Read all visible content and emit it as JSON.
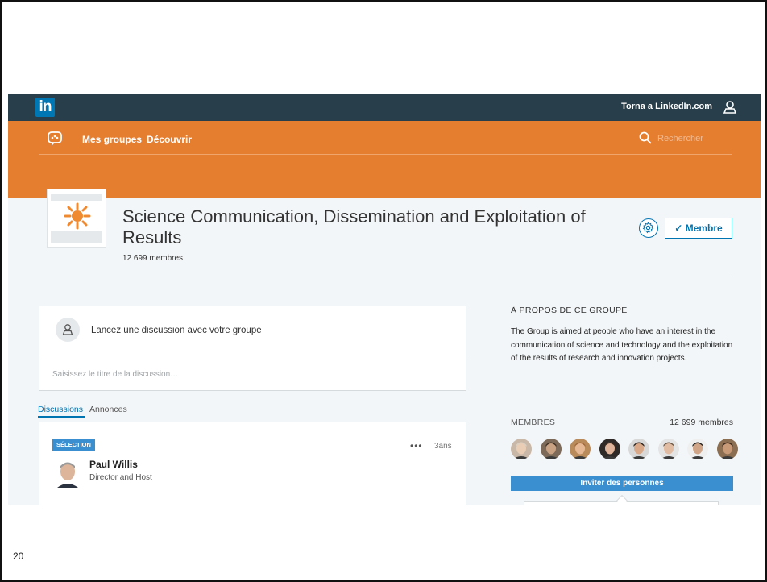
{
  "topbar": {
    "logo_text": "in",
    "back_link": "Torna a LinkedIn.com"
  },
  "nav": {
    "my_groups": "Mes groupes",
    "discover": "Découvrir",
    "search_placeholder": "Rechercher"
  },
  "group": {
    "title": "Science Communication, Dissemination and Exploitation of Results",
    "member_count": "12 699 membres",
    "member_button": "✓ Membre"
  },
  "discussion": {
    "prompt": "Lancez une discussion avec votre groupe",
    "title_placeholder": "Saisissez le titre de la discussion…"
  },
  "tabs": {
    "discussions": "Discussions",
    "announcements": "Annonces"
  },
  "post": {
    "badge": "SÉLECTION",
    "more": "•••",
    "time": "3ans",
    "author": "Paul Willis",
    "role": "Director and Host"
  },
  "about": {
    "heading": "À PROPOS DE CE GROUPE",
    "text": "The Group is aimed at people who have an interest in the communication of science and technology and the exploitation of the results of research and innovation projects."
  },
  "members": {
    "heading": "MEMBRES",
    "count": "12 699 membres",
    "invite_button": "Inviter des personnes",
    "faces": [
      {
        "name": "member-avatar-1",
        "bg": "#c9b8a8",
        "skin": "#e9cdb5",
        "hair": "#d8d0c4"
      },
      {
        "name": "member-avatar-2",
        "bg": "#7d6a58",
        "skin": "#c9a283",
        "hair": "#3d2f25"
      },
      {
        "name": "member-avatar-3",
        "bg": "#b98a5a",
        "skin": "#e6b894",
        "hair": "#a0683a"
      },
      {
        "name": "member-avatar-4",
        "bg": "#2f2a28",
        "skin": "#e0b49a",
        "hair": "#3a2a20"
      },
      {
        "name": "member-avatar-5",
        "bg": "#d8d8d8",
        "skin": "#d8a888",
        "hair": "#2a2220"
      },
      {
        "name": "member-avatar-6",
        "bg": "#e4e4e4",
        "skin": "#e1bca2",
        "hair": "#6a5848"
      },
      {
        "name": "member-avatar-7",
        "bg": "#efefef",
        "skin": "#cfa487",
        "hair": "#222222"
      },
      {
        "name": "member-avatar-8",
        "bg": "#8c6f52",
        "skin": "#c89a78",
        "hair": "#3d2a1d"
      }
    ]
  },
  "colors": {
    "topbar": "#283e4a",
    "orange": "#e67e30",
    "accent_blue": "#0073b1",
    "button_blue": "#3a8fd1"
  },
  "slide": {
    "page_number": "20"
  }
}
